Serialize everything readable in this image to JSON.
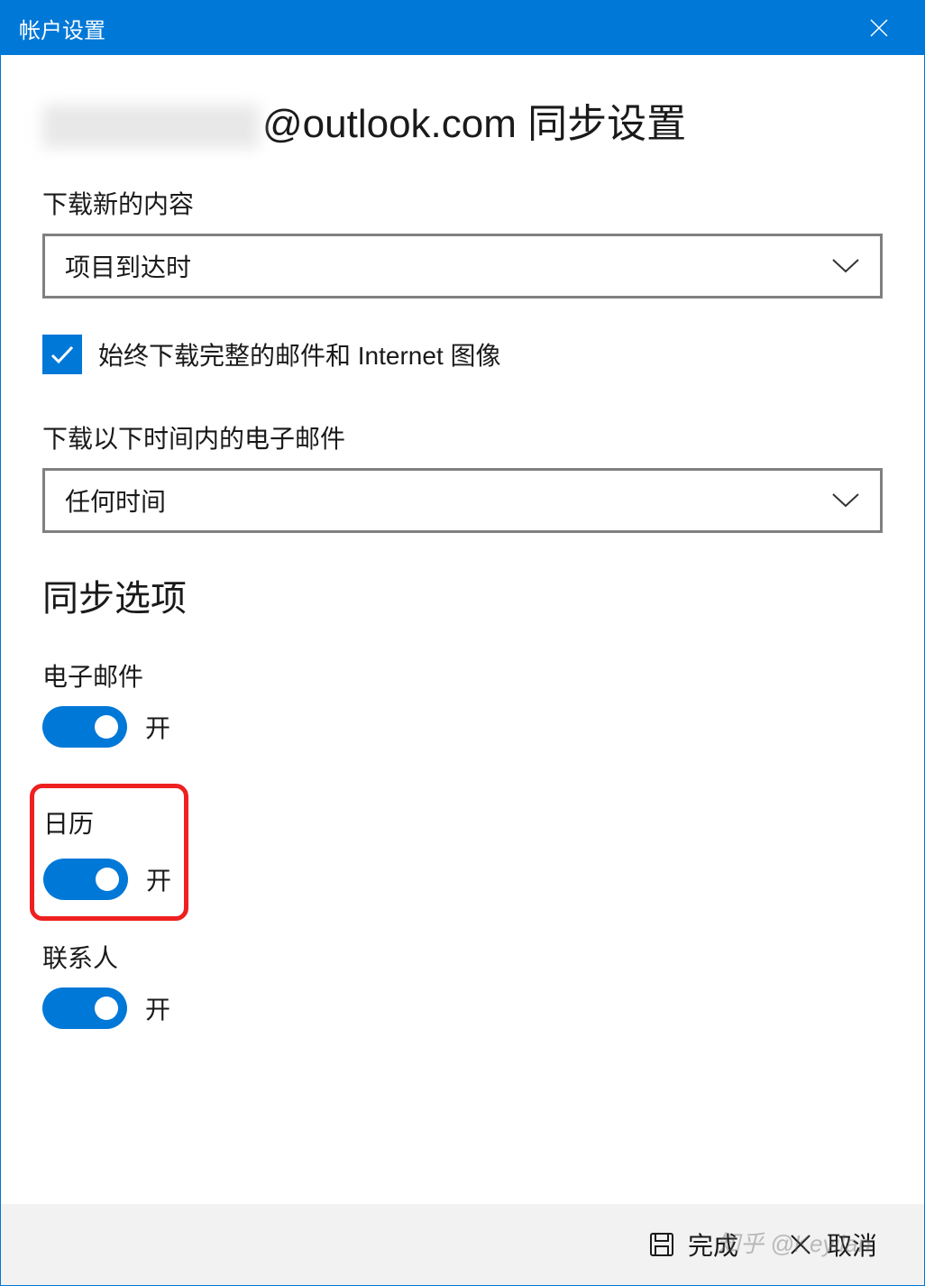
{
  "titlebar": {
    "title": "帐户设置"
  },
  "page": {
    "title_suffix": "@outlook.com 同步设置"
  },
  "download_new": {
    "label": "下载新的内容",
    "selected": "项目到达时"
  },
  "full_download": {
    "label": "始终下载完整的邮件和 Internet 图像",
    "checked": true
  },
  "download_time": {
    "label": "下载以下时间内的电子邮件",
    "selected": "任何时间"
  },
  "sync": {
    "heading": "同步选项",
    "email": {
      "label": "电子邮件",
      "state": "开"
    },
    "calendar": {
      "label": "日历",
      "state": "开"
    },
    "contacts": {
      "label": "联系人",
      "state": "开"
    }
  },
  "footer": {
    "done": "完成",
    "cancel": "取消"
  },
  "watermark": "知乎 @Keyilan"
}
